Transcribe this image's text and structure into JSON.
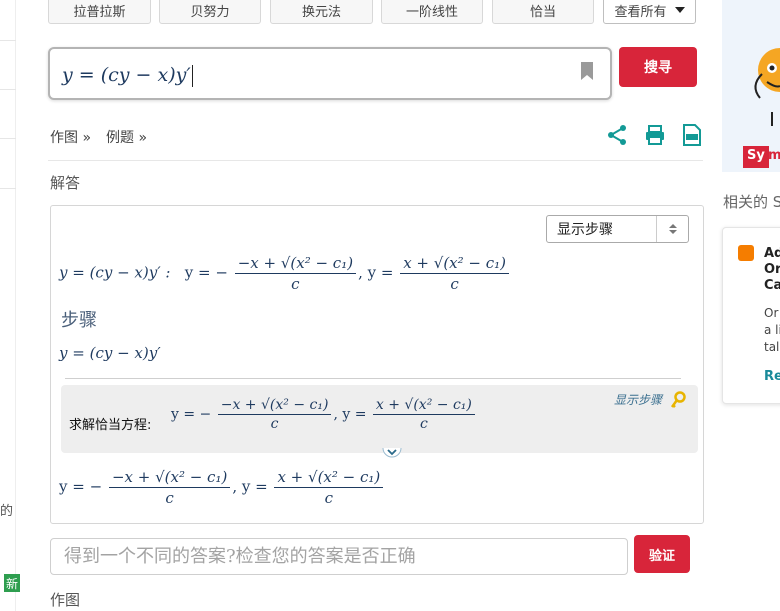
{
  "top_chips": [
    {
      "label": "拉普拉斯"
    },
    {
      "label": "贝努力"
    },
    {
      "label": "换元法"
    },
    {
      "label": "一阶线性"
    },
    {
      "label": "恰当"
    }
  ],
  "view_all": "查看所有",
  "search": {
    "button_label": "搜寻",
    "expression": {
      "lhs": "y",
      "rhs": "(cy − x)y′"
    }
  },
  "tools": {
    "plot": "作图 »",
    "examples": "例题 »"
  },
  "icons": [
    "share-icon",
    "print-icon",
    "pdf-icon",
    "bookmark-icon",
    "key-icon",
    "chevron-down-icon",
    "blogger-icon"
  ],
  "solution": {
    "header": "解答",
    "steps_select": "显示步骤",
    "equation": {
      "lhs": "y",
      "rhs": "(cy − x)y′"
    },
    "result_intro": "y = (cy − x)y′ :",
    "numerator_1": "−x + √(x² − c₁)",
    "numerator_2": "x + √(x² − c₁)",
    "denominator": "c",
    "steps_heading": "步骤",
    "step_label": "求解恰当方程:",
    "show_steps_link": "显示步骤"
  },
  "check": {
    "placeholder": "得到一个不同的答案?检查您的答案是否正确",
    "button_label": "验证"
  },
  "plot_section": "作图",
  "left_strip": {
    "fragment": "的",
    "badge": "新"
  },
  "right": {
    "logo_prefix": "Sy",
    "logo_rest": "mb",
    "related_title": "相关的 S",
    "blog_card": {
      "title_lines": [
        "Ad",
        "Or",
        "Ca"
      ],
      "desc_lines": [
        "Or",
        "a li",
        "tal"
      ],
      "read_more": "Re"
    }
  },
  "colors": {
    "accent_red": "#d8253a",
    "teal": "#139a96",
    "math_blue": "#1e3a5f"
  }
}
